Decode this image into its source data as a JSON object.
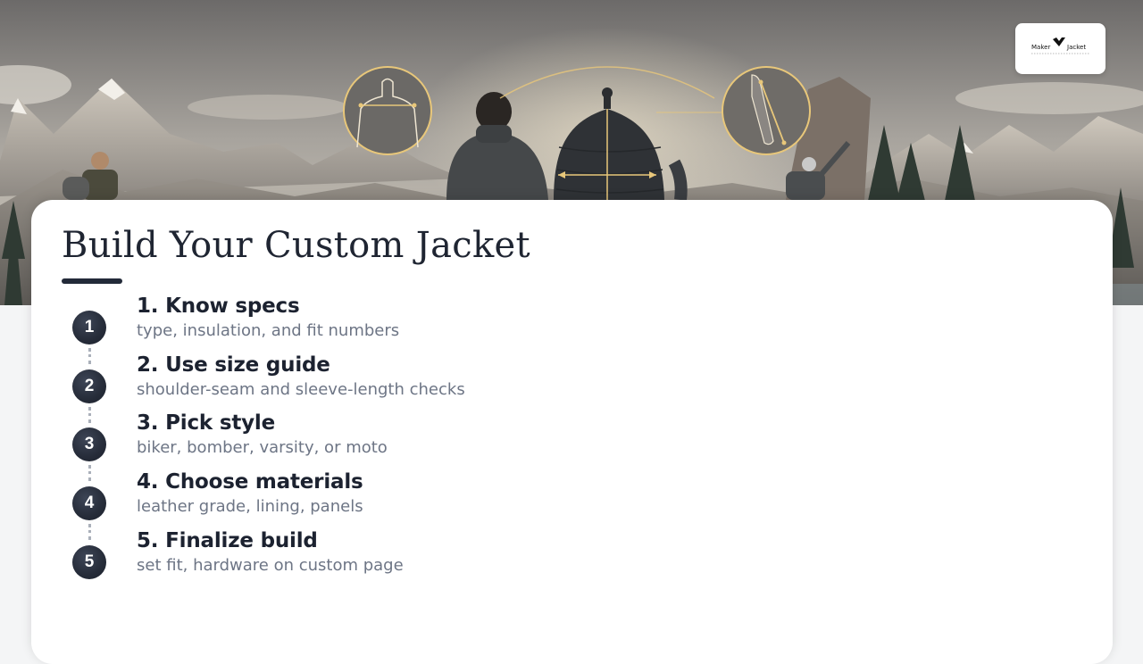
{
  "hero": {
    "description_icon": "mountain-landscape-jacket-illustration"
  },
  "brand": {
    "logo_text": "Maker Jacket",
    "logo_icon": "eagle-logo-icon"
  },
  "page": {
    "title": "Build Your Custom Jacket"
  },
  "steps": [
    {
      "number": "1",
      "title": "1. Know specs",
      "description": "type, insulation, and fit numbers"
    },
    {
      "number": "2",
      "title": "2. Use size guide",
      "description": "shoulder-seam and sleeve-length checks"
    },
    {
      "number": "3",
      "title": "3. Pick style",
      "description": "biker, bomber, varsity, or moto"
    },
    {
      "number": "4",
      "title": "4. Choose materials",
      "description": "leather grade, lining, panels"
    },
    {
      "number": "5",
      "title": "5. Finalize build",
      "description": "set fit, hardware on custom page"
    }
  ],
  "colors": {
    "title": "#1f2532",
    "badge": "#262c39",
    "description": "#6d7585",
    "accent_gold": "#e8c77a"
  }
}
